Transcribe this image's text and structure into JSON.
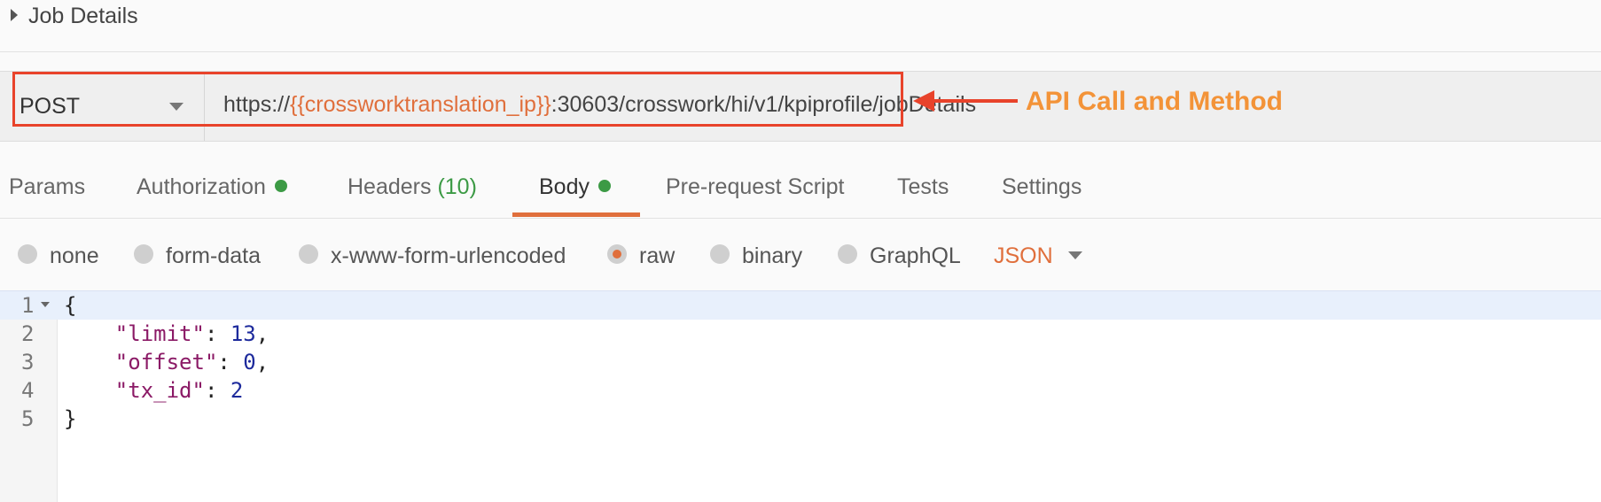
{
  "job_details": {
    "title": "Job Details",
    "icon": "caret-right-icon"
  },
  "request": {
    "method": "POST",
    "url_prefix": "https://",
    "url_variable": "{{crossworktranslation_ip}}",
    "url_suffix": ":30603/crosswork/hi/v1/kpiprofile/jobDetails"
  },
  "annotation": {
    "label": "API Call and Method",
    "color": "#f39338"
  },
  "tabs": [
    {
      "label": "Params",
      "count": "",
      "dot": false
    },
    {
      "label": "Authorization",
      "count": "",
      "dot": true
    },
    {
      "label": "Headers",
      "count": "(10)",
      "dot": false
    },
    {
      "label": "Body",
      "count": "",
      "dot": true,
      "active": true
    },
    {
      "label": "Pre-request Script",
      "count": "",
      "dot": false
    },
    {
      "label": "Tests",
      "count": "",
      "dot": false
    },
    {
      "label": "Settings",
      "count": "",
      "dot": false
    }
  ],
  "body_types": [
    {
      "label": "none",
      "checked": false
    },
    {
      "label": "form-data",
      "checked": false
    },
    {
      "label": "x-www-form-urlencoded",
      "checked": false
    },
    {
      "label": "raw",
      "checked": true
    },
    {
      "label": "binary",
      "checked": false
    },
    {
      "label": "GraphQL",
      "checked": false
    }
  ],
  "body_language": "JSON",
  "editor": {
    "lines": [
      {
        "num": "1",
        "open": "{"
      },
      {
        "num": "2",
        "key": "\"limit\"",
        "sep": ": ",
        "value": "13",
        "end": ","
      },
      {
        "num": "3",
        "key": "\"offset\"",
        "sep": ": ",
        "value": "0",
        "end": ","
      },
      {
        "num": "4",
        "key": "\"tx_id\"",
        "sep": ": ",
        "value": "2",
        "end": ""
      },
      {
        "num": "5",
        "close": "}"
      }
    ]
  },
  "colors": {
    "accent": "#e06f3c",
    "status_dot": "#3c9a45",
    "annotation_red": "#e8432b"
  }
}
